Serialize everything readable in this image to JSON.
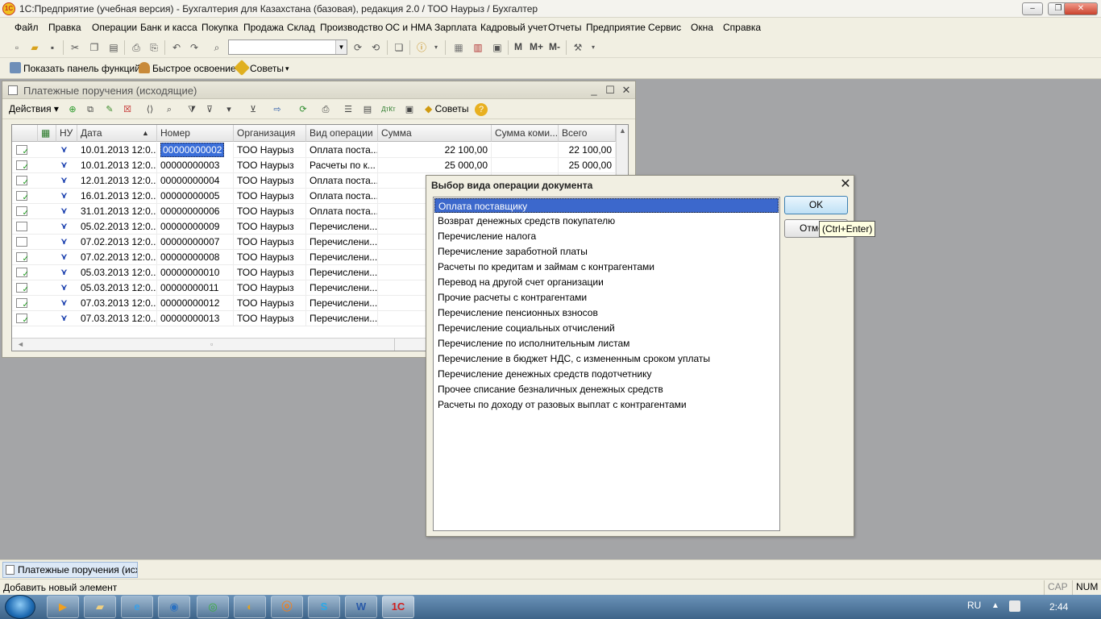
{
  "window": {
    "title": "1С:Предприятие (учебная версия) - Бухгалтерия для Казахстана (базовая), редакция 2.0 / ТОО Наурыз / Бухгалтер",
    "logo_text": "1С"
  },
  "menu": {
    "items": [
      "Файл",
      "Правка",
      "Операции",
      "Банк и касса",
      "Покупка",
      "Продажа",
      "Склад",
      "Производство",
      "ОС и НМА",
      "Зарплата",
      "Кадровый учет",
      "Отчеты",
      "Предприятие",
      "Сервис",
      "Окна",
      "Справка"
    ]
  },
  "toolbar": {
    "search_value": "",
    "m": "M",
    "m_plus": "M+",
    "m_minus": "M-"
  },
  "toolbar2": {
    "functions_panel": "Показать панель функций",
    "quick_start": "Быстрое освоение",
    "tips": "Советы"
  },
  "child_window": {
    "title": "Платежные поручения (исходящие)",
    "actions_label": "Действия",
    "tips_label": "Советы"
  },
  "table": {
    "headers": {
      "nu": "НУ",
      "date": "Дата",
      "number": "Номер",
      "org": "Организация",
      "op": "Вид операции",
      "sum": "Сумма",
      "commission": "Сумма коми...",
      "total": "Всего"
    },
    "rows": [
      {
        "date": "10.01.2013 12:0...",
        "number": "00000000002",
        "org": "ТОО Наурыз",
        "op": "Оплата поста...",
        "sum": "22 100,00",
        "commission": "",
        "total": "22 100,00"
      },
      {
        "date": "10.01.2013 12:0...",
        "number": "00000000003",
        "org": "ТОО Наурыз",
        "op": "Расчеты по к...",
        "sum": "25 000,00",
        "commission": "",
        "total": "25 000,00"
      },
      {
        "date": "12.01.2013 12:0...",
        "number": "00000000004",
        "org": "ТОО Наурыз",
        "op": "Оплата поста...",
        "sum": "",
        "commission": "",
        "total": ""
      },
      {
        "date": "16.01.2013 12:0...",
        "number": "00000000005",
        "org": "ТОО Наурыз",
        "op": "Оплата поста...",
        "sum": "",
        "commission": "",
        "total": ""
      },
      {
        "date": "31.01.2013 12:0...",
        "number": "00000000006",
        "org": "ТОО Наурыз",
        "op": "Оплата поста...",
        "sum": "",
        "commission": "",
        "total": ""
      },
      {
        "date": "05.02.2013 12:0...",
        "number": "00000000009",
        "org": "ТОО Наурыз",
        "op": "Перечислени...",
        "sum": "",
        "commission": "",
        "total": ""
      },
      {
        "date": "07.02.2013 12:0...",
        "number": "00000000007",
        "org": "ТОО Наурыз",
        "op": "Перечислени...",
        "sum": "",
        "commission": "",
        "total": ""
      },
      {
        "date": "07.02.2013 12:0...",
        "number": "00000000008",
        "org": "ТОО Наурыз",
        "op": "Перечислени...",
        "sum": "",
        "commission": "",
        "total": ""
      },
      {
        "date": "05.03.2013 12:0...",
        "number": "00000000010",
        "org": "ТОО Наурыз",
        "op": "Перечислени...",
        "sum": "",
        "commission": "",
        "total": ""
      },
      {
        "date": "05.03.2013 12:0...",
        "number": "00000000011",
        "org": "ТОО Наурыз",
        "op": "Перечислени...",
        "sum": "",
        "commission": "",
        "total": ""
      },
      {
        "date": "07.03.2013 12:0...",
        "number": "00000000012",
        "org": "ТОО Наурыз",
        "op": "Перечислени...",
        "sum": "",
        "commission": "",
        "total": ""
      },
      {
        "date": "07.03.2013 12:0...",
        "number": "00000000013",
        "org": "ТОО Наурыз",
        "op": "Перечислени...",
        "sum": "",
        "commission": "",
        "total": ""
      }
    ]
  },
  "dialog": {
    "title": "Выбор вида операции документа",
    "ok_label": "OK",
    "cancel_label": "Отме",
    "tooltip": "(Ctrl+Enter)",
    "items": [
      "Оплата поставщику",
      "Возврат денежных средств покупателю",
      "Перечисление налога",
      "Перечисление заработной платы",
      "Расчеты по кредитам и займам с контрагентами",
      "Перевод на другой счет организации",
      "Прочие расчеты с контрагентами",
      "Перечисление пенсионных взносов",
      "Перечисление социальных отчислений",
      "Перечисление по исполнительным листам",
      "Перечисление в бюджет НДС, с измененным сроком уплаты",
      "Перечисление денежных средств подотчетнику",
      "Прочее списание безналичных денежных средств",
      "Расчеты по доходу от разовых выплат с контрагентами"
    ]
  },
  "windows_bar": {
    "tab_label": "Платежные поручения (исх..."
  },
  "status": {
    "text": "Добавить новый элемент",
    "cap": "CAP",
    "num": "NUM"
  },
  "taskbar": {
    "lang": "RU",
    "clock": "2:44"
  },
  "colors": {
    "selection": "#3c68cc",
    "workspace": "#a4a5a7",
    "chrome": "#f1efe2"
  }
}
